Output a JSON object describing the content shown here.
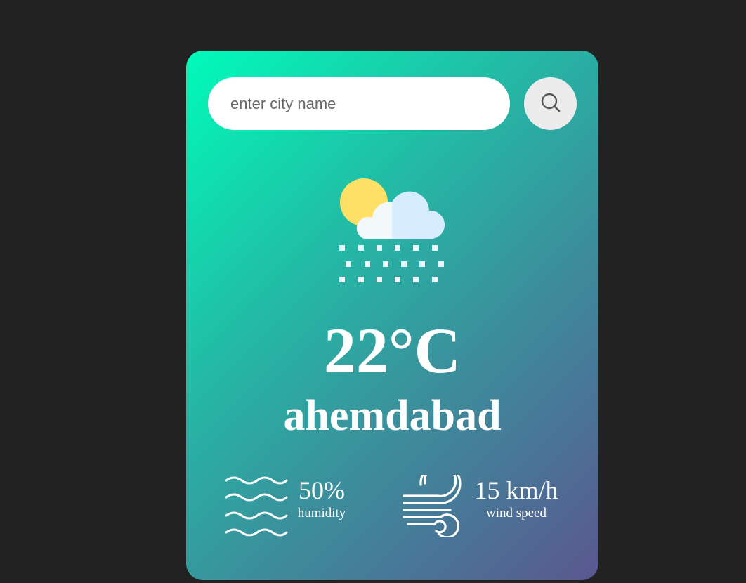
{
  "search": {
    "placeholder": "enter city name",
    "button_icon": "search-icon"
  },
  "weather": {
    "icon": "snow-cloud-sun-icon",
    "temperature": "22°C",
    "city": "ahemdabad"
  },
  "details": {
    "humidity": {
      "icon": "humidity-waves-icon",
      "value": "50%",
      "label": "humidity"
    },
    "wind": {
      "icon": "wind-icon",
      "value": "15 km/h",
      "label": "wind speed"
    }
  },
  "colors": {
    "page_background": "#222222",
    "card_gradient_start": "#00fcb9",
    "card_gradient_end": "#5b5790",
    "sun": "#ffe066",
    "cloud_light": "#f3f8fb",
    "cloud_shade": "#d6ecff"
  }
}
